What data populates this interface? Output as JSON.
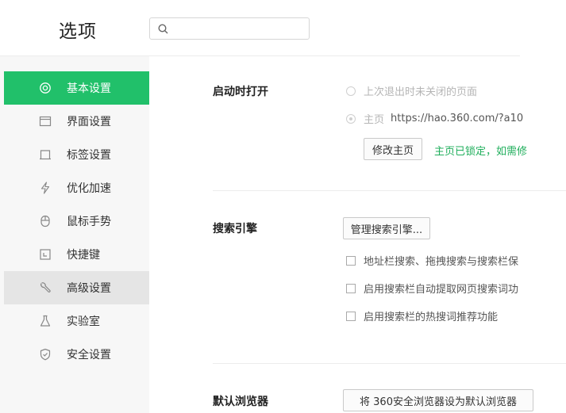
{
  "header": {
    "title": "选项",
    "search": {
      "value": "",
      "placeholder": ""
    }
  },
  "sidebar": {
    "items": [
      {
        "label": "基本设置",
        "icon": "gear-icon"
      },
      {
        "label": "界面设置",
        "icon": "window-icon"
      },
      {
        "label": "标签设置",
        "icon": "tab-icon"
      },
      {
        "label": "优化加速",
        "icon": "lightning-icon"
      },
      {
        "label": "鼠标手势",
        "icon": "mouse-icon"
      },
      {
        "label": "快捷键",
        "icon": "shortcut-key-icon"
      },
      {
        "label": "高级设置",
        "icon": "wrench-icon"
      },
      {
        "label": "实验室",
        "icon": "flask-icon"
      },
      {
        "label": "安全设置",
        "icon": "shield-icon"
      }
    ],
    "active_index": 0
  },
  "startup": {
    "title": "启动时打开",
    "option_last_session": "上次退出时未关闭的页面",
    "option_homepage_label": "主页",
    "homepage_url": "https://hao.360.com/?a10",
    "modify_button": "修改主页",
    "locked_text": "主页已锁定，如需修"
  },
  "search_engine": {
    "title": "搜索引擎",
    "manage_button": "管理搜索引擎...",
    "options": [
      "地址栏搜索、拖拽搜索与搜索栏保",
      "启用搜索栏自动提取网页搜索词功",
      "启用搜索栏的热搜词推荐功能"
    ]
  },
  "default_browser": {
    "title": "默认浏览器",
    "button": "将 360安全浏览器设为默认浏览器"
  },
  "colors": {
    "accent": "#21c06a",
    "sidebar_bg": "#f7f7f7",
    "hover_bg": "#e5e5e5"
  }
}
